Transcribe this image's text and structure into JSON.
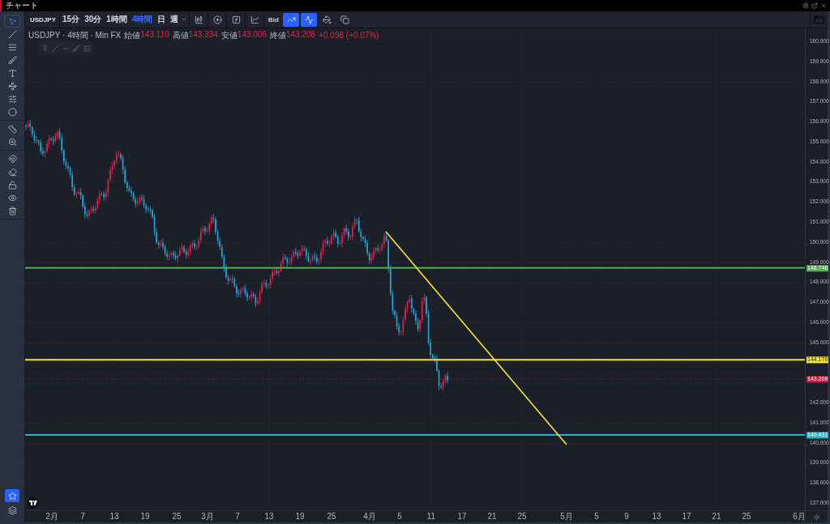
{
  "window": {
    "title": "チャート"
  },
  "left_toolbar": {
    "tools": [
      {
        "selected": true
      },
      {
        "selected": false
      },
      {
        "selected": false
      },
      {
        "selected": false
      },
      {
        "selected": false
      },
      {
        "selected": false
      },
      {
        "selected": false
      },
      {
        "selected": false
      },
      {
        "selected": false
      },
      {
        "selected": false
      },
      {
        "selected": false
      },
      {
        "selected": false
      },
      {
        "selected": false
      },
      {
        "selected": false
      },
      {
        "selected": false
      }
    ],
    "favorites": {
      "selected": true
    }
  },
  "top_toolbar": {
    "symbol": "USDJPY",
    "timeframes": [
      {
        "label": "15分",
        "selected": false
      },
      {
        "label": "30分",
        "selected": false
      },
      {
        "label": "1時間",
        "selected": false
      },
      {
        "label": "4時間",
        "selected": true
      },
      {
        "label": "日",
        "selected": false
      },
      {
        "label": "週",
        "selected": false
      }
    ],
    "price_source": "Bid",
    "toggles": [
      {
        "on": true
      },
      {
        "on": true
      },
      {
        "on": false
      },
      {
        "on": false
      }
    ]
  },
  "legend": {
    "title": "USDJPY · 4時間 · Min FX",
    "values": [
      {
        "label": "始値",
        "value": "143.110"
      },
      {
        "label": "高値",
        "value": "143.334"
      },
      {
        "label": "安値",
        "value": "143.006"
      },
      {
        "label": "終値",
        "value": "143.208"
      }
    ],
    "change": "+0.098 (+0.07%)"
  },
  "price_axis": {
    "ticks": [
      "160.000",
      "159.000",
      "158.000",
      "157.000",
      "156.000",
      "155.000",
      "154.000",
      "153.000",
      "152.000",
      "151.000",
      "150.000",
      "149.000",
      "148.000",
      "147.000",
      "146.000",
      "145.000",
      "142.000",
      "141.000",
      "140.000",
      "139.000",
      "138.000",
      "137.000"
    ]
  },
  "price_lines": [
    {
      "label": "148.746",
      "color": "#4caf50",
      "kind": "horizontal"
    },
    {
      "label": "144.170",
      "color": "#f5e52f",
      "kind": "horizontal"
    },
    {
      "label": "143.208",
      "color": "#d3173f",
      "kind": "current"
    },
    {
      "label": "140.431",
      "color": "#1fb8d0",
      "kind": "horizontal"
    }
  ],
  "time_axis": {
    "ticks": [
      "2月",
      "7",
      "13",
      "19",
      "25",
      "3月",
      "7",
      "13",
      "19",
      "25",
      "4月",
      "5",
      "11",
      "17",
      "21",
      "25",
      "5月",
      "5",
      "9",
      "13",
      "17",
      "21",
      "25",
      "6月"
    ]
  }
}
